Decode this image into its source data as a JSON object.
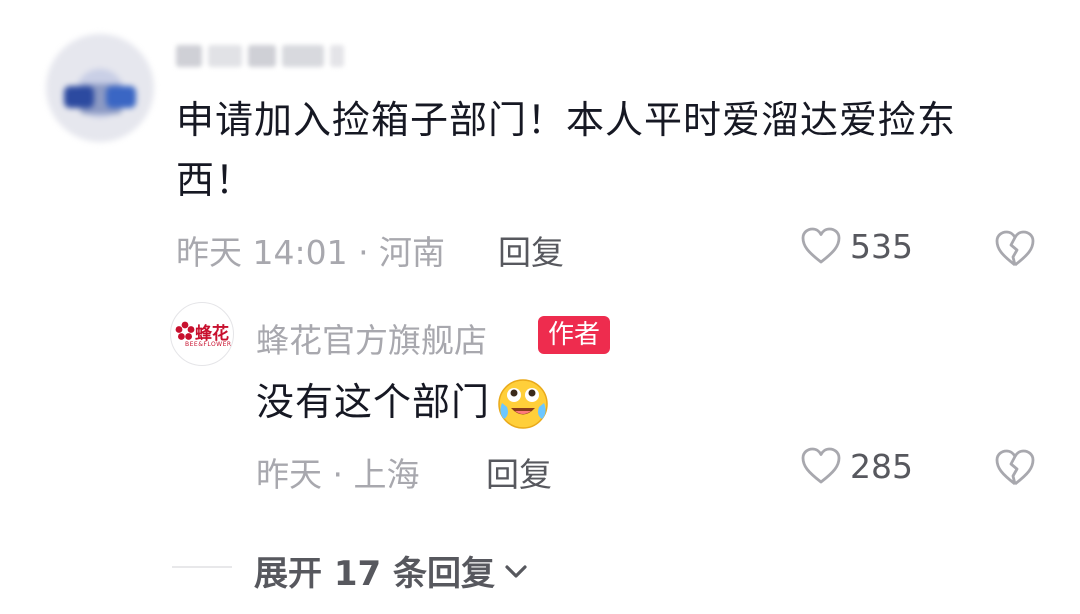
{
  "comment": {
    "text": "申请加入捡箱子部门！本人平时爱溜达爱捡东西！",
    "time_location": "昨天 14:01 · 河南",
    "reply_label": "回复",
    "like_count": "535"
  },
  "reply": {
    "author_name": "蜂花官方旗舰店",
    "author_badge": "作者",
    "avatar_brand": "蜂花",
    "avatar_brand_sub": "BEE&FLOWER",
    "text": "没有这个部门",
    "emoji": "crying-laughing-emoji",
    "time_location": "昨天 · 上海",
    "reply_label": "回复",
    "like_count": "285"
  },
  "expand": {
    "label": "展开 17 条回复"
  },
  "colors": {
    "primary_text": "#161823",
    "secondary_text": "#a8a8ae",
    "action_text": "#57585e",
    "author_badge": "#ee2c4e",
    "brand_red": "#c8102e"
  }
}
